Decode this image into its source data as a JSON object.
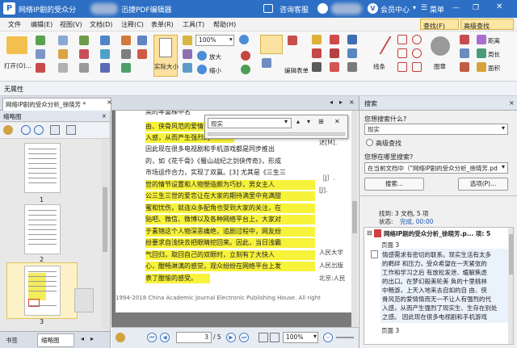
{
  "titlebar": {
    "doc_title": "网络IP剧的受众分",
    "app_name": "迅捷PDF编辑器",
    "consult": "咨询客服",
    "member": "会员中心",
    "menu": "菜单"
  },
  "menu": [
    "文件",
    "编辑(E)",
    "视图(V)",
    "文档(D)",
    "注释(C)",
    "表单(R)",
    "工具(T)",
    "帮助(H)"
  ],
  "quicktabs": {
    "find": "查找(F)",
    "advanced": "高级查找"
  },
  "ribbon": {
    "open": "打开(O)...",
    "actual_size": "实际大小",
    "zoom_value": "100%",
    "zoom_in": "放大",
    "zoom_out": "缩小",
    "edit_form": "编辑表单",
    "lines": "线条",
    "stamp": "图章",
    "distance": "距离",
    "perimeter": "周长",
    "area": "面积"
  },
  "propbar": {
    "label": "无属性"
  },
  "doctab": {
    "label": "网络IP剧的受众分析_徐晓芳 *"
  },
  "leftpanel": {
    "header": "缩略图",
    "pages": [
      "1",
      "2",
      "3"
    ],
    "tabs": [
      "书签",
      "缩略图"
    ]
  },
  "findpop": {
    "value": "现实"
  },
  "document": {
    "lines": [
      "类的年重株中名",
      "由、侠骨风范的爱情",
      "入感，从而产生强烈的",
      "因此现在很多电视剧和手机游戏都是同步推出",
      "的，如《花千骨》《蜀山战纪之剑侠传奇》，形成",
      "市场运作合力，实现了双赢。[3] 尤其是《三生三",
      "世的情节设置和人物塑造颇为巧妙，男女主人",
      "公三生三世的爱恋让在大家的期待满里中充满甜",
      "蜜和忧伤，就连众多配角也受到大家的关注，在",
      "贴吧、微信、微博以及各种网络平台上，大家对",
      "于素锦这个人物深恶痛绝，追剧过程中，网友纷",
      "纷要求自浅快去把眼睛挖回来。因此，当日浅霸",
      "气回归，取回自己的双眼时，立刻有了大快人",
      "心，酣畅淋漓的感觉，观众纷纷在网络平台上发",
      "表了酣愉的感受。"
    ],
    "right": [
      "述[M].",
      "［J］.",
      "[J].",
      "人民大学",
      "人民出版",
      "北京:人民"
    ],
    "footer": "1994-2018 China Academic Journal Electronic Publishing House. All right"
  },
  "bottombar": {
    "page": "3",
    "total": "/ 5",
    "zoom": "100%"
  },
  "search": {
    "panel_title": "搜索",
    "what_label": "您想搜索什么?",
    "query": "现实",
    "advanced": "高级查找",
    "where_label": "您想在哪里搜索?",
    "scope": "在当前文档中（\"网络IP剧的受众分析_徐晓芳.pd",
    "search_btn": "搜索...",
    "options_btn": "选项(P)...",
    "found": "找到: 3 文档, 5 项",
    "status_label": "状态: ",
    "status_value": "完成, 00:00",
    "result_title": "网络IP剧的受众分析_徐晓芳.p...  项: 5",
    "r1_page": "页面 3",
    "r1_lines": [
      "情感需求有密切的联系。现实生活有太多",
      "的羁绊 和压力，受众希望在一天紧张的",
      "工作和学习之后 有放松发泄、缓解焦虑",
      "的出口。在梦幻般美轮美 奂的十里桃林",
      "中畅游，上天入地来去自如的自 由、侠",
      "骨风范的爱情情而无一不让人有强烈的代",
      "入感，从而产生强烈了现实生、生存在别处",
      "之感。 因此现在很多电视剧和手机游戏"
    ],
    "r2_page": "页面 3"
  }
}
